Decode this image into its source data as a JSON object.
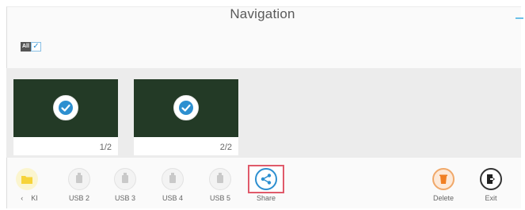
{
  "header": {
    "title": "Navigation"
  },
  "select_all": {
    "tag": "All",
    "checked": true
  },
  "pages": [
    {
      "label": "1/2",
      "selected": true
    },
    {
      "label": "2/2",
      "selected": true
    }
  ],
  "toolbar": {
    "items": [
      {
        "label": "KI",
        "icon": "folder-icon"
      },
      {
        "label": "USB 2",
        "icon": "usb-icon"
      },
      {
        "label": "USB 3",
        "icon": "usb-icon"
      },
      {
        "label": "USB 4",
        "icon": "usb-icon"
      },
      {
        "label": "USB 5",
        "icon": "usb-icon"
      },
      {
        "label": "Share",
        "icon": "share-icon"
      },
      {
        "label": "Delete",
        "icon": "delete-icon"
      },
      {
        "label": "Exit",
        "icon": "exit-icon"
      }
    ]
  },
  "colors": {
    "preview_bg": "#233a26",
    "check_blue": "#2d8fd0",
    "share_highlight": "#e05a6a",
    "delete_orange": "#f07f23",
    "folder_yellow": "#f6d33a"
  }
}
